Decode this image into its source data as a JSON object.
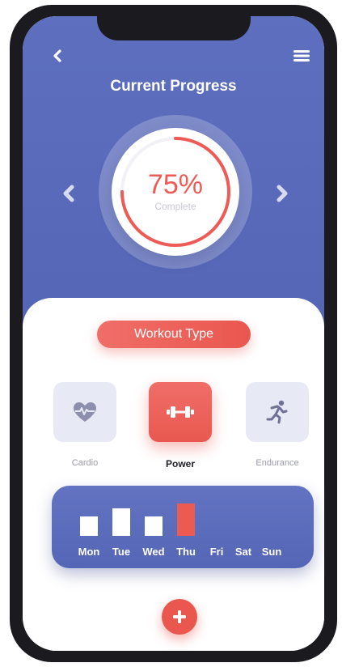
{
  "header": {
    "title": "Current Progress",
    "back_icon": "chevron-left-icon",
    "menu_icon": "hamburger-menu-icon"
  },
  "progress": {
    "percent_label": "75%",
    "percent_value": 75,
    "caption": "Complete",
    "prev_icon": "chevron-left-icon",
    "next_icon": "chevron-right-icon"
  },
  "workout": {
    "section_label": "Workout Type",
    "types": [
      {
        "label": "Cardio",
        "icon": "heart-rate-icon",
        "selected": false
      },
      {
        "label": "Power",
        "icon": "dumbbell-icon",
        "selected": true
      },
      {
        "label": "Endurance",
        "icon": "running-person-icon",
        "selected": false
      }
    ]
  },
  "chart_data": {
    "type": "bar",
    "categories": [
      "Mon",
      "Tue",
      "Wed",
      "Thu",
      "Fri",
      "Sat",
      "Sun"
    ],
    "values": [
      0.6,
      0.85,
      0.6,
      1.0,
      0,
      0,
      0
    ],
    "highlight": "Thu",
    "title": "",
    "xlabel": "",
    "ylabel": ""
  },
  "actions": {
    "add_icon": "plus-icon"
  },
  "colors": {
    "primary": "#5e6fbf",
    "accent": "#e9574f",
    "tile_bg": "#e7e9f5",
    "muted_text": "#9a9aa8"
  }
}
